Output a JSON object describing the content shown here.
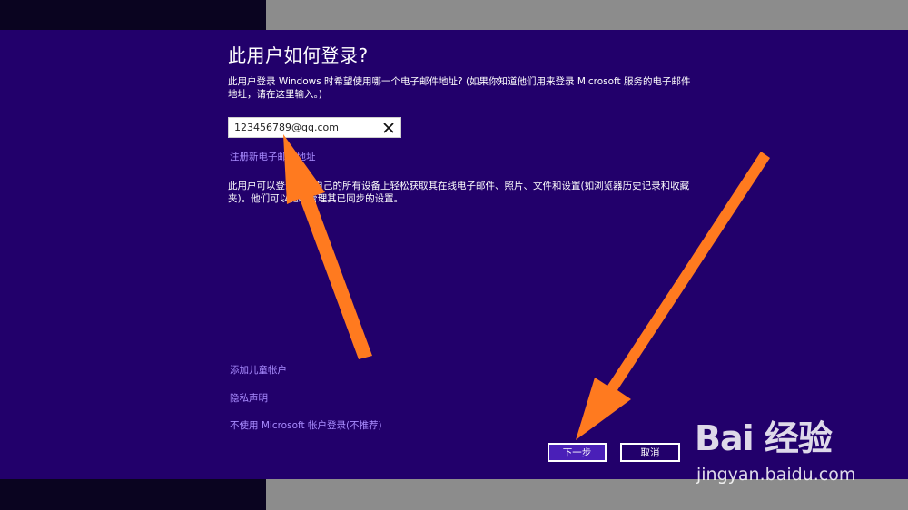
{
  "dialog": {
    "title": "此用户如何登录?",
    "description": "此用户登录 Windows 时希望使用哪一个电子邮件地址? (如果你知道他们用来登录 Microsoft 服务的电子邮件地址，请在这里输入。)",
    "email_value": "123456789@qq.com",
    "register_link": "注册新电子邮件地址",
    "info_text": "此用户可以登录以在自己的所有设备上轻松获取其在线电子邮件、照片、文件和设置(如浏览器历史记录和收藏夹)。他们可以随时管理其已同步的设置。",
    "add_child_link": "添加儿童帐户",
    "privacy_link": "隐私声明",
    "local_account_link": "不使用 Microsoft 帐户登录(不推荐)",
    "next_button": "下一步",
    "cancel_button": "取消"
  },
  "watermark": {
    "logo_text": "Bai 经验",
    "url": "jingyan.baidu.com"
  },
  "icons": {
    "clear": "close-icon",
    "annotation": "arrow-icon"
  },
  "colors": {
    "panel_bg": "#22006b",
    "link": "#a98cff",
    "primary_button": "#4a1fb8",
    "annotation_arrow": "#ff7a1f"
  }
}
